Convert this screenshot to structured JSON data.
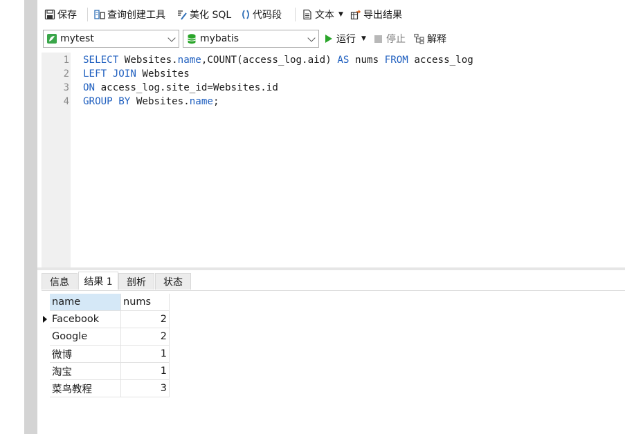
{
  "toolbar": {
    "save": "保存",
    "query_builder": "查询创建工具",
    "beautify_sql": "美化 SQL",
    "snippet": "代码段",
    "text": "文本",
    "export": "导出结果"
  },
  "selectors": {
    "connection": "mytest",
    "database": "mybatis",
    "run": "运行",
    "stop": "停止",
    "explain": "解释"
  },
  "editor": {
    "line_numbers": [
      "1",
      "2",
      "3",
      "4"
    ],
    "lines": [
      [
        [
          "kw",
          "SELECT"
        ],
        [
          "t",
          " Websites."
        ],
        [
          "kw",
          "name"
        ],
        [
          "t",
          ",COUNT(access_log.aid) "
        ],
        [
          "kw",
          "AS"
        ],
        [
          "t",
          " nums "
        ],
        [
          "kw",
          "FROM"
        ],
        [
          "t",
          " access_log"
        ]
      ],
      [
        [
          "kw",
          "LEFT JOIN"
        ],
        [
          "t",
          " Websites"
        ]
      ],
      [
        [
          "kw",
          "ON"
        ],
        [
          "t",
          " access_log.site_id=Websites.id"
        ]
      ],
      [
        [
          "kw",
          "GROUP BY"
        ],
        [
          "t",
          " Websites."
        ],
        [
          "kw",
          "name"
        ],
        [
          "t",
          ";"
        ]
      ]
    ]
  },
  "tabs": [
    "信息",
    "结果 1",
    "剖析",
    "状态"
  ],
  "results": {
    "columns": [
      "name",
      "nums"
    ],
    "rows": [
      [
        "Facebook",
        "2"
      ],
      [
        "Google",
        "2"
      ],
      [
        "微博",
        "1"
      ],
      [
        "淘宝",
        "1"
      ],
      [
        "菜鸟教程",
        "3"
      ]
    ]
  },
  "colors": {
    "keyword": "#1f5fbf",
    "header_selected": "#d5e8f7",
    "run_green": "#2aa52a"
  }
}
